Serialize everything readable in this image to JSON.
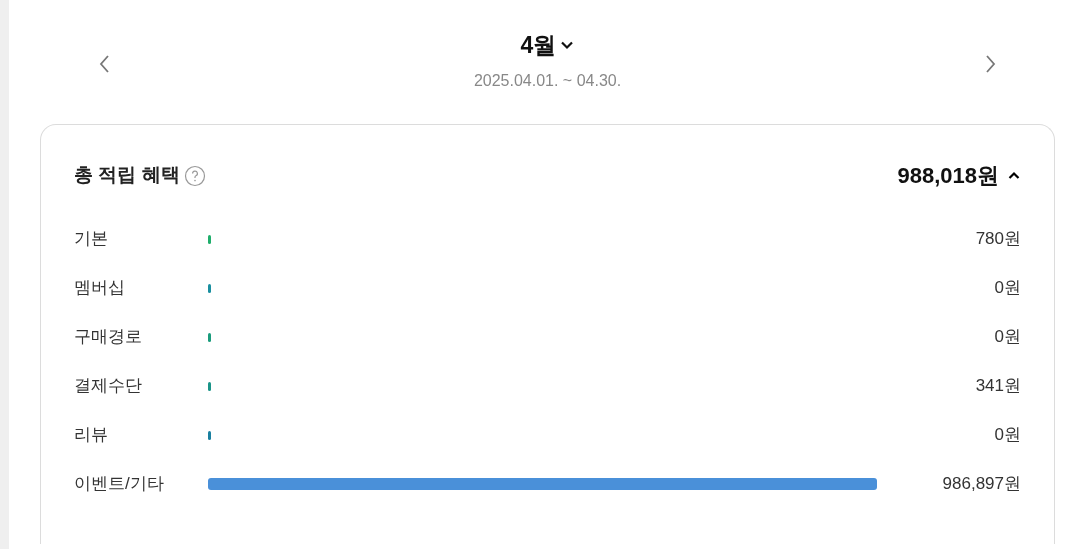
{
  "period": {
    "month": "4월",
    "range": "2025.04.01. ~ 04.30."
  },
  "summary": {
    "title": "총 적립 혜택",
    "total": "988,018원",
    "expanded": true,
    "items": [
      {
        "label": "기본",
        "color": "#1fae6b",
        "amount": "780원"
      },
      {
        "label": "멤버십",
        "color": "#1a8fa0",
        "amount": "0원"
      },
      {
        "label": "구매경로",
        "color": "#1a9c7c",
        "amount": "0원"
      },
      {
        "label": "결제수단",
        "color": "#1a9488",
        "amount": "341원"
      },
      {
        "label": "리뷰",
        "color": "#1a80a0",
        "amount": "0원"
      },
      {
        "label": "이벤트/기타",
        "color": "#4a90d9",
        "amount": "986,897원"
      }
    ]
  }
}
